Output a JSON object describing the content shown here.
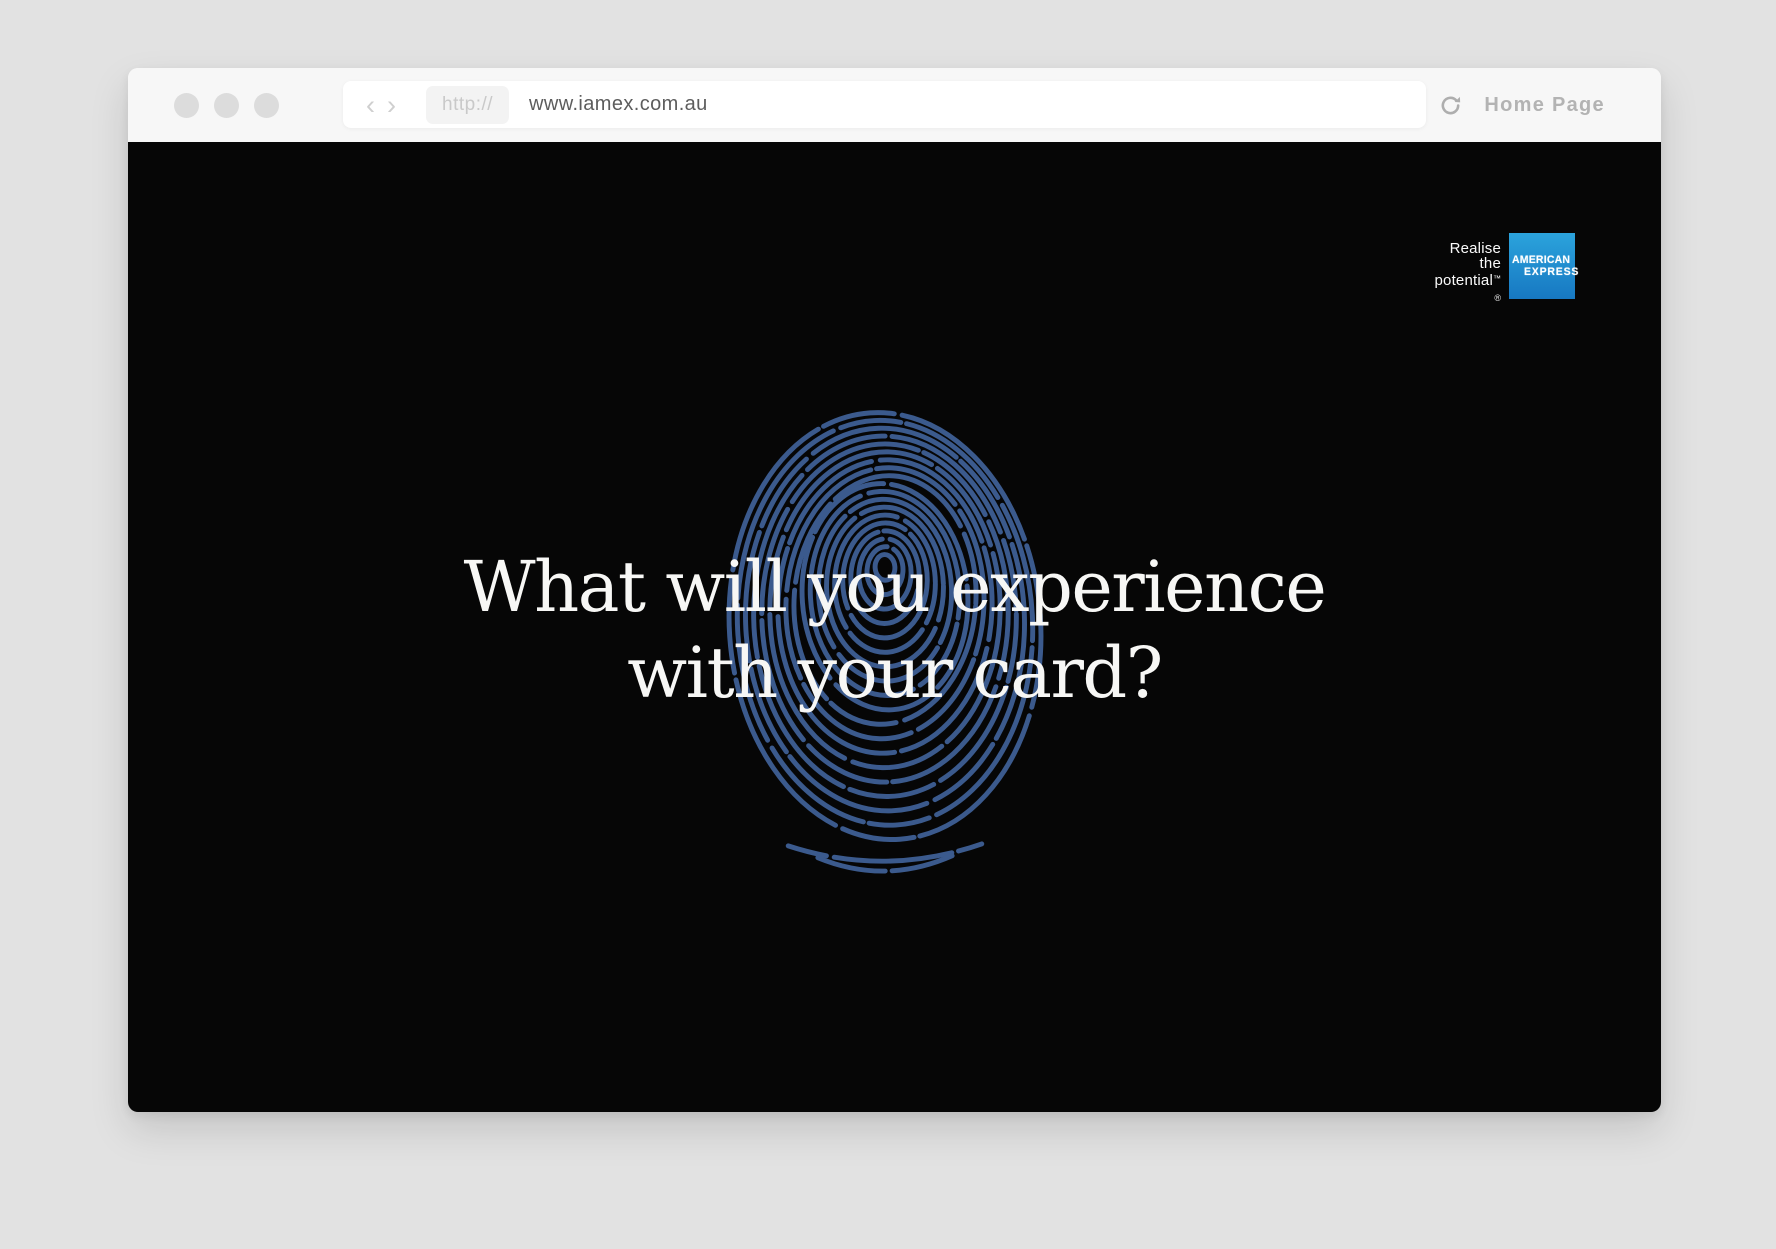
{
  "browser": {
    "back_glyph": "‹",
    "forward_glyph": "›",
    "protocol_chip": "http://",
    "url": "www.iamex.com.au",
    "home_label": "Home Page"
  },
  "brand": {
    "tagline_line1": "Realise",
    "tagline_line2": "the",
    "tagline_line3": "potential",
    "trademark": "™",
    "registered": "®",
    "logo_line1": "AMERICAN",
    "logo_line2": "EXPRESS"
  },
  "hero": {
    "headline_line1": "What will you experience",
    "headline_line2": "with your card?"
  },
  "colors": {
    "fingerprint": "#3b5a8d",
    "amex_blue_top": "#2ba3dc",
    "amex_blue_bottom": "#1778c2",
    "headline_text": "#f7f7f5",
    "content_bg": "#060606"
  }
}
